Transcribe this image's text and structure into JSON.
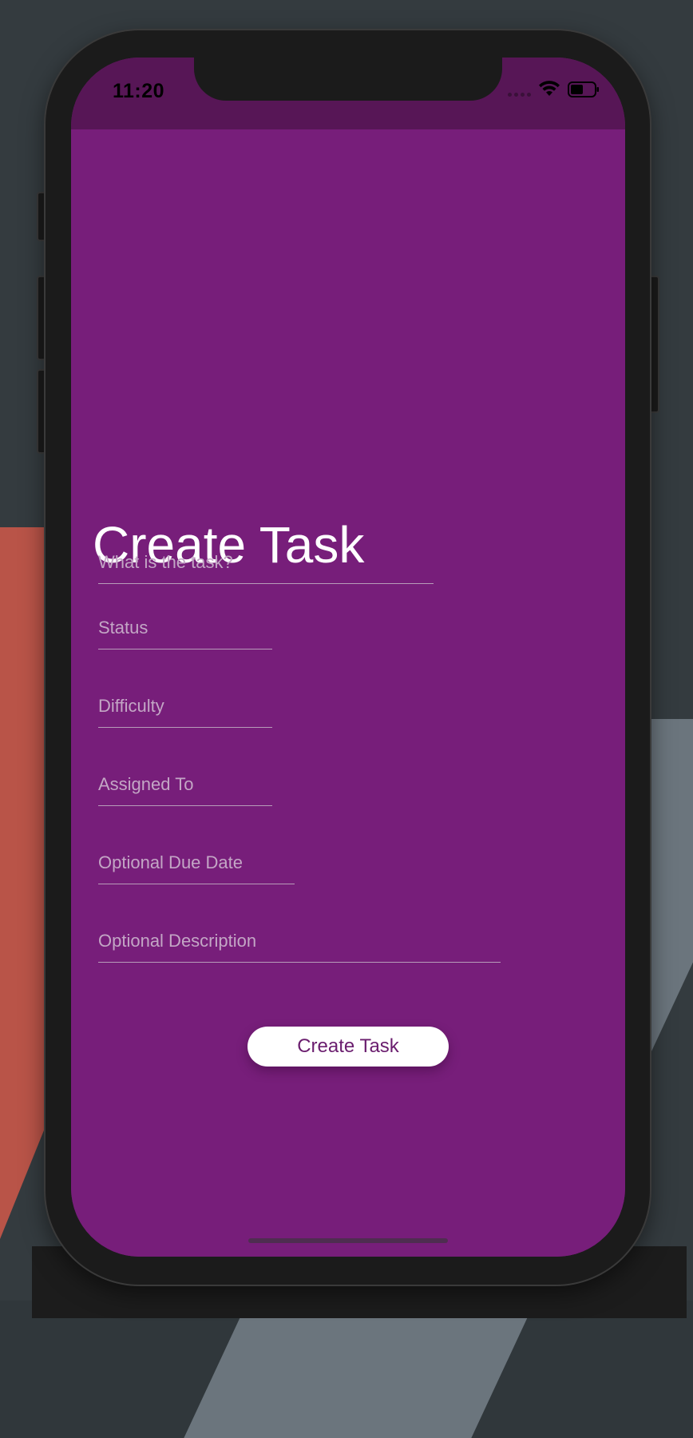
{
  "status_bar": {
    "time": "11:20"
  },
  "form": {
    "title": "Create Task",
    "fields": [
      {
        "placeholder": "What is the task?",
        "value": ""
      },
      {
        "placeholder": "Status",
        "value": ""
      },
      {
        "placeholder": "Difficulty",
        "value": ""
      },
      {
        "placeholder": "Assigned To",
        "value": ""
      },
      {
        "placeholder": "Optional Due Date",
        "value": ""
      },
      {
        "placeholder": "Optional Description",
        "value": ""
      }
    ],
    "submit_label": "Create Task"
  },
  "colors": {
    "background": "#771e7a",
    "status_bar": "#571656",
    "button_bg": "#ffffff",
    "button_text": "#6a1d6e",
    "placeholder": "#c3a6c5"
  }
}
